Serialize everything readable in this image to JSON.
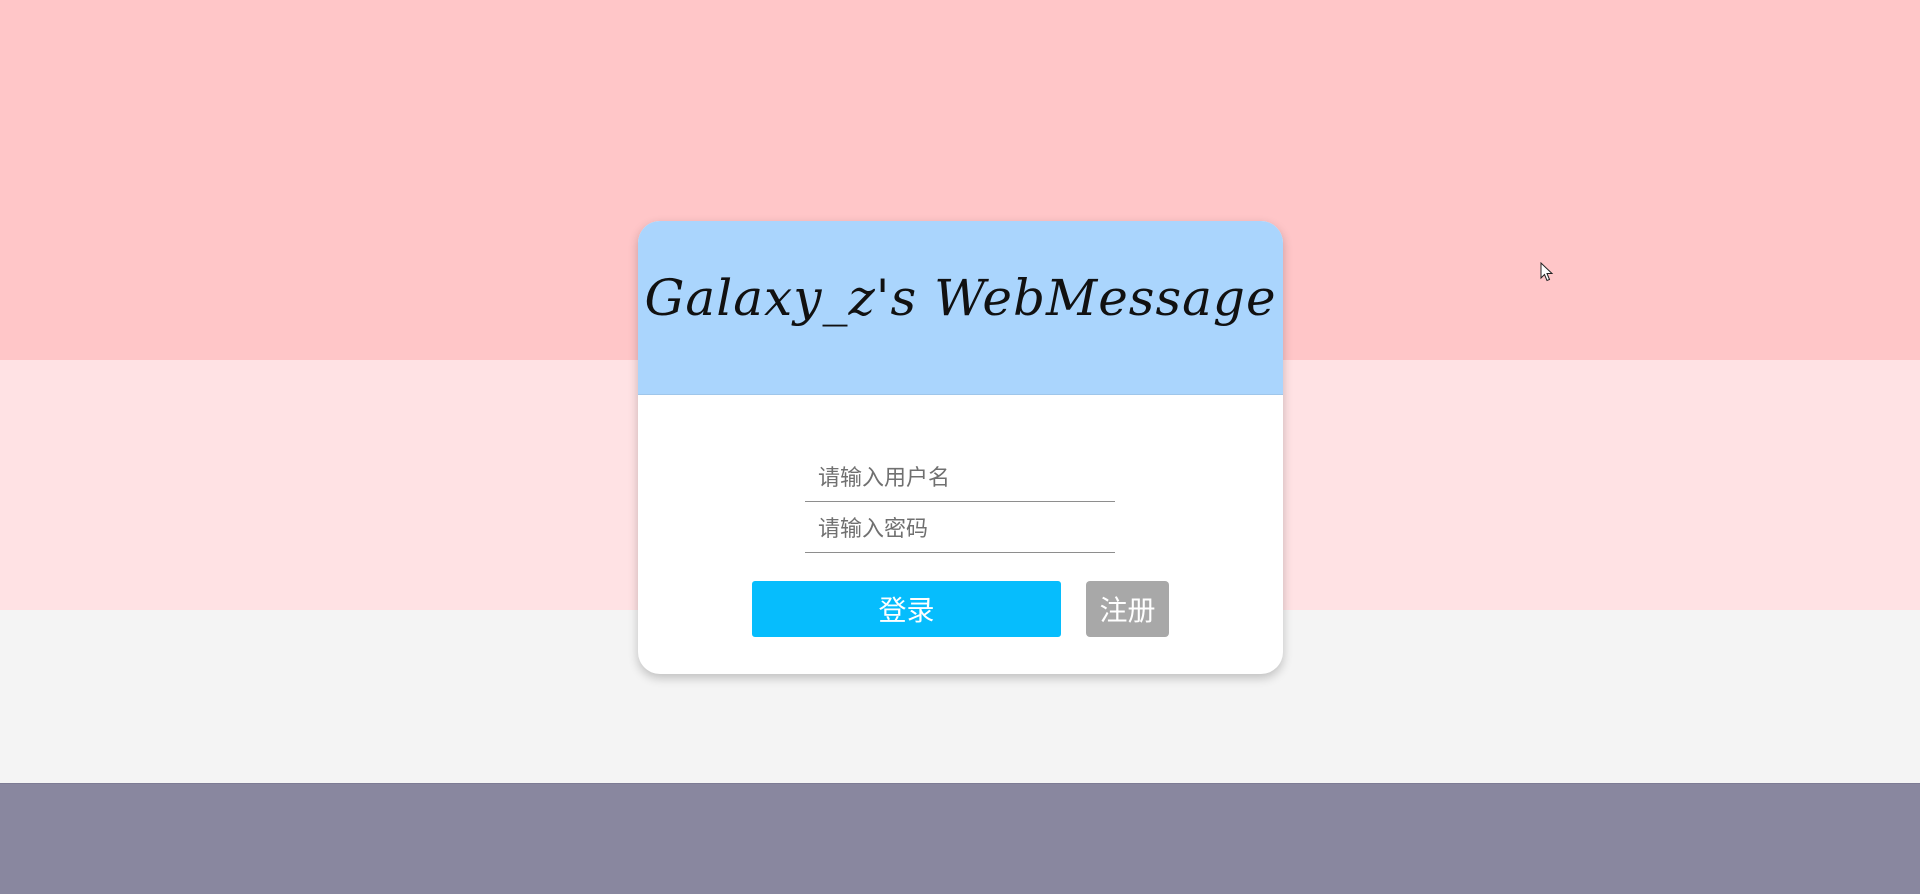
{
  "page": {
    "colors": {
      "band_top": "#ffc6c8",
      "band_mid": "#ffe2e4",
      "band_light": "#f4f4f4",
      "band_bottom": "#89879f",
      "header_bg": "#aad5fd",
      "login_button": "#06bdfd",
      "register_button": "#a8a8a8"
    }
  },
  "login_card": {
    "title": "Galaxy_z's WebMessage",
    "username": {
      "placeholder": "请输入用户名",
      "value": ""
    },
    "password": {
      "placeholder": "请输入密码",
      "value": ""
    },
    "login_label": "登录",
    "register_label": "注册"
  },
  "cursor": {
    "icon": "mouse-pointer-icon"
  }
}
